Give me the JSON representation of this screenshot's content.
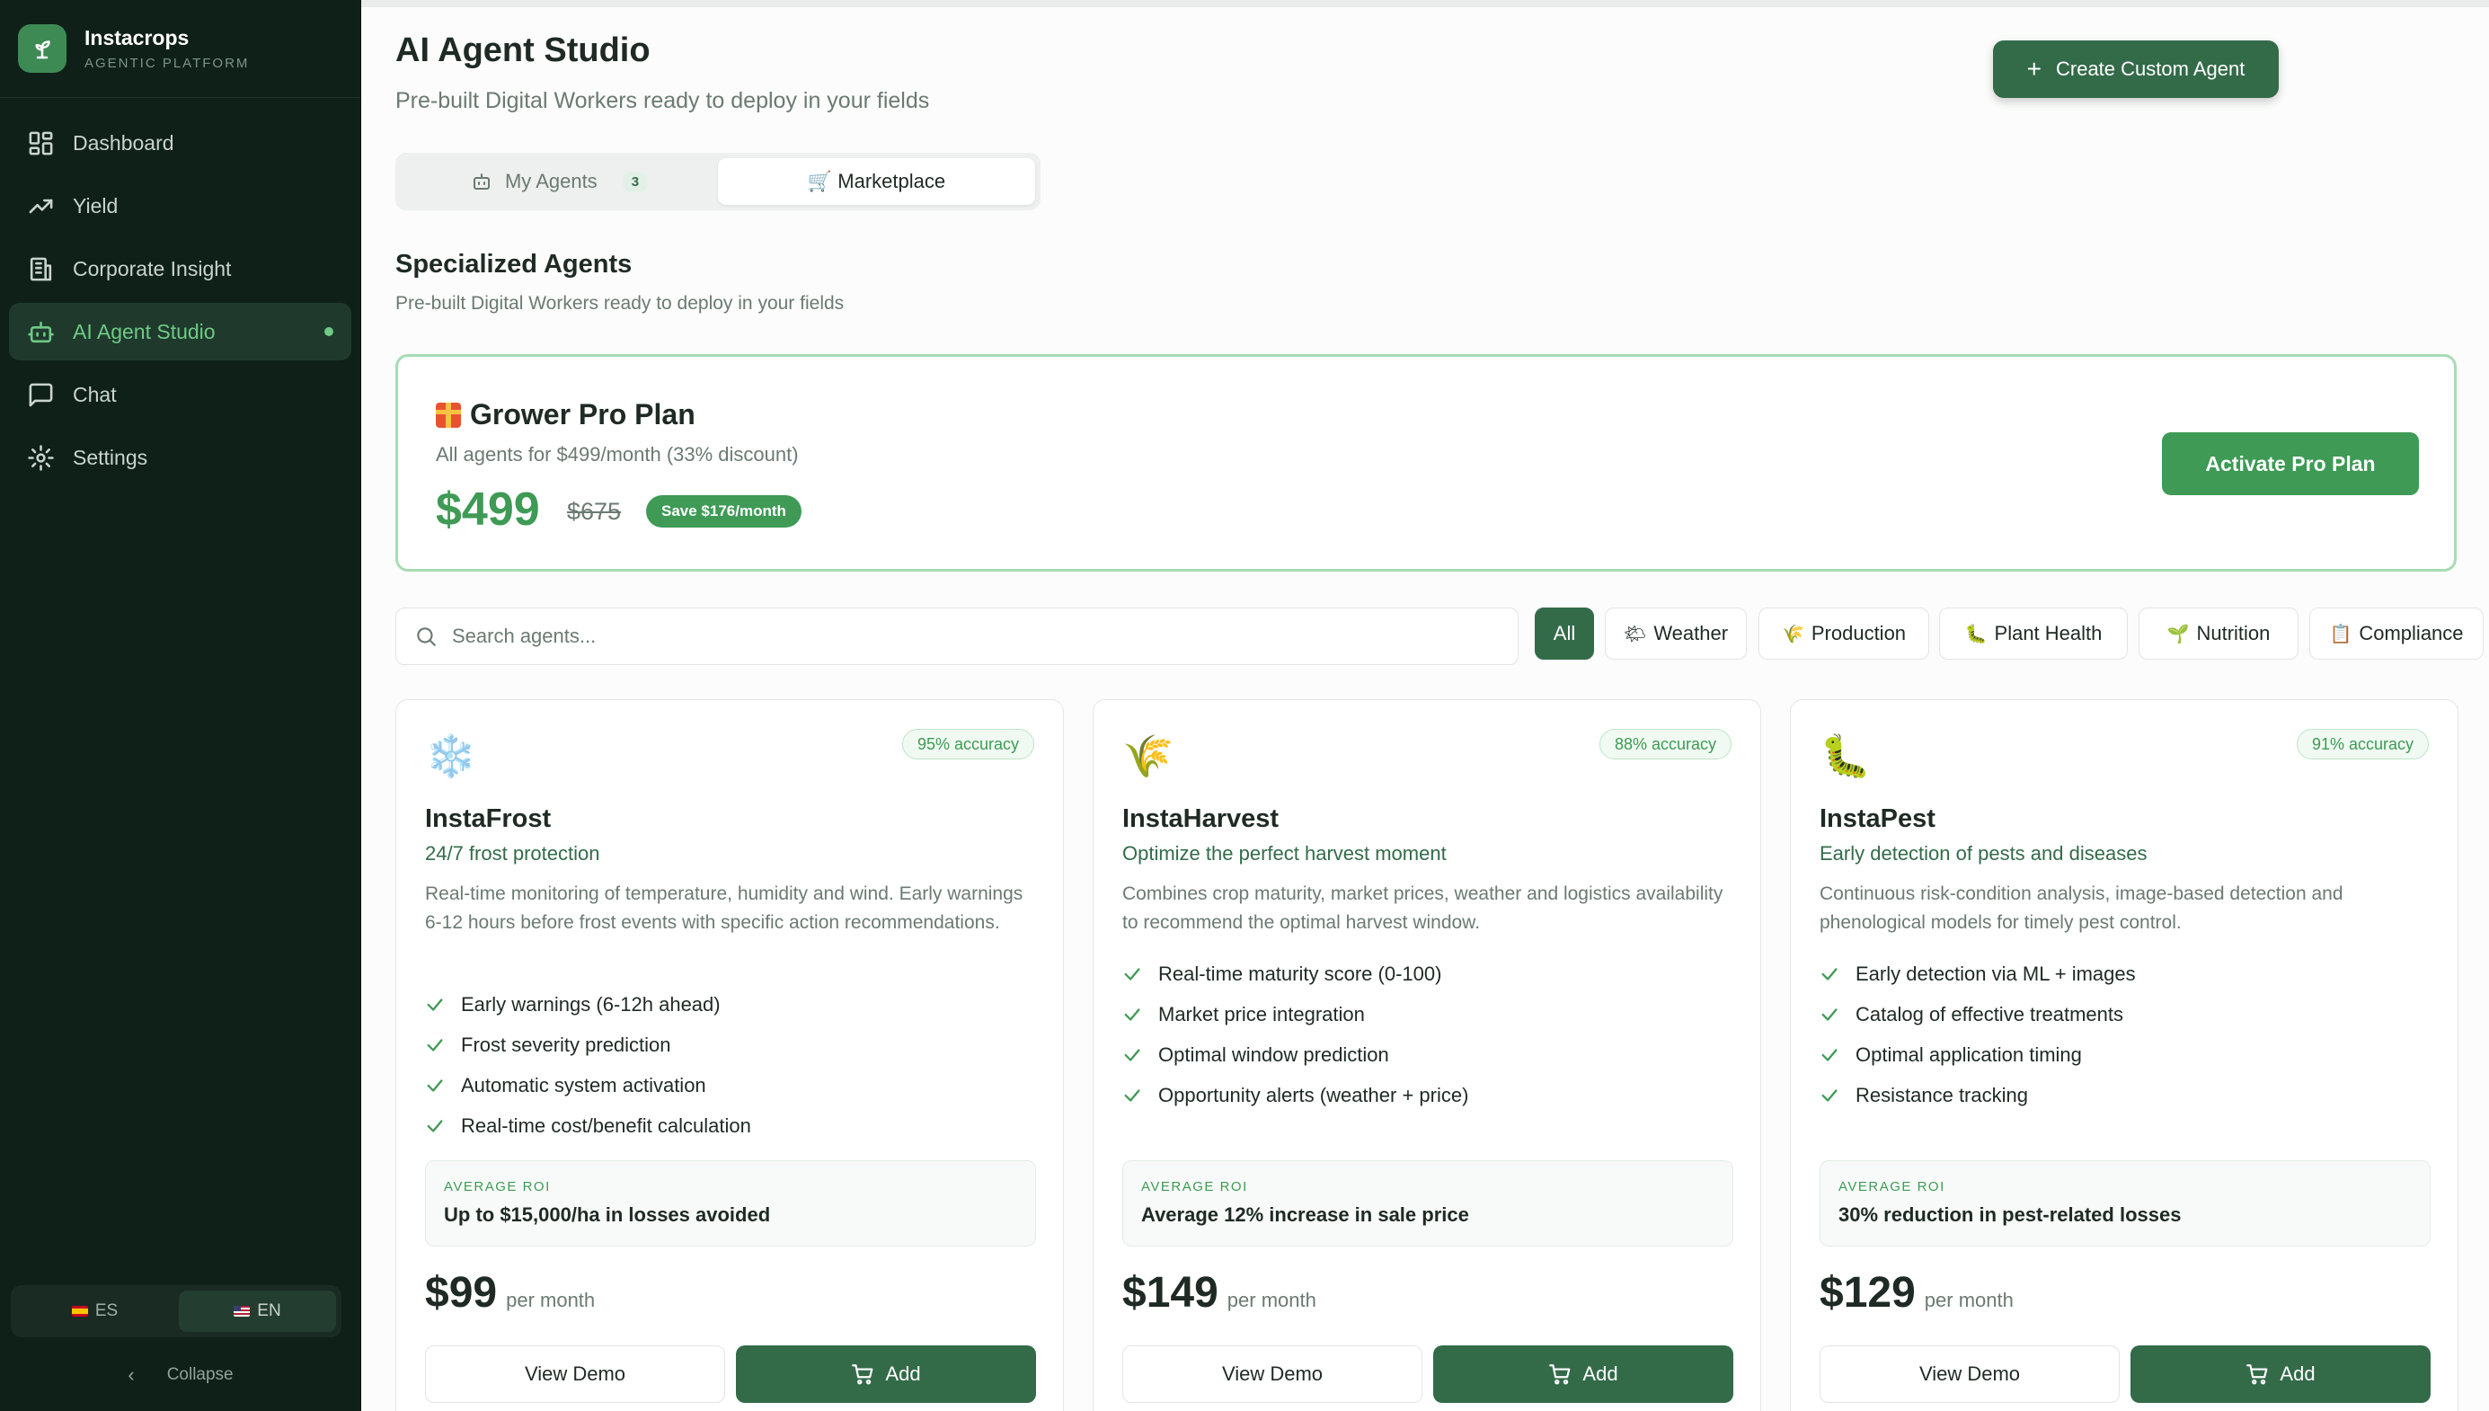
{
  "brand": {
    "name": "Instacrops",
    "subtitle": "AGENTIC PLATFORM",
    "icon": "sprout-icon"
  },
  "sidebar": {
    "items": [
      {
        "label": "Dashboard",
        "icon": "dashboard-grid-icon",
        "active": false
      },
      {
        "label": "Yield",
        "icon": "trending-up-icon",
        "active": false
      },
      {
        "label": "Corporate Insight",
        "icon": "building-icon",
        "active": false
      },
      {
        "label": "AI Agent Studio",
        "icon": "bot-icon",
        "active": true
      },
      {
        "label": "Chat",
        "icon": "chat-bubble-icon",
        "active": false
      },
      {
        "label": "Settings",
        "icon": "gear-icon",
        "active": false
      }
    ],
    "languages": [
      {
        "label": "ES",
        "flag": "es-flag-icon",
        "active": false
      },
      {
        "label": "EN",
        "flag": "us-flag-icon",
        "active": true
      }
    ],
    "collapse_label": "Collapse"
  },
  "header": {
    "title": "AI Agent Studio",
    "subtitle": "Pre-built Digital Workers ready to deploy in your fields",
    "create_button": "Create Custom Agent"
  },
  "tabs": [
    {
      "label": "My Agents",
      "count": "3",
      "active": false
    },
    {
      "label": "Marketplace",
      "active": true
    }
  ],
  "section": {
    "title": "Specialized Agents",
    "subtitle": "Pre-built Digital Workers ready to deploy in your fields"
  },
  "pro_plan": {
    "title": "Grower Pro Plan",
    "description": "All agents for $499/month (33% discount)",
    "price": "$499",
    "old_price": "$675",
    "savings": "Save $176/month",
    "button": "Activate Pro Plan"
  },
  "search": {
    "placeholder": "Search agents..."
  },
  "filters": [
    {
      "label": "All",
      "icon": "",
      "active": true
    },
    {
      "label": "Weather",
      "icon": "sun-cloud-icon",
      "active": false
    },
    {
      "label": "Production",
      "icon": "wheat-icon",
      "active": false
    },
    {
      "label": "Plant Health",
      "icon": "bug-icon",
      "active": false
    },
    {
      "label": "Nutrition",
      "icon": "seedling-icon",
      "active": false
    },
    {
      "label": "Compliance",
      "icon": "clipboard-icon",
      "active": false
    }
  ],
  "agents": [
    {
      "name": "InstaFrost",
      "icon": "snowflake-icon",
      "accuracy": "95% accuracy",
      "tagline": "24/7 frost protection",
      "description": "Real-time monitoring of temperature, humidity and wind. Early warnings 6-12 hours before frost events with specific action recommendations.",
      "features": [
        "Early warnings (6-12h ahead)",
        "Frost severity prediction",
        "Automatic system activation",
        "Real-time cost/benefit calculation"
      ],
      "roi_label": "AVERAGE ROI",
      "roi_value": "Up to $15,000/ha in losses avoided",
      "price": "$99",
      "period": "per month",
      "demo_label": "View Demo",
      "add_label": "Add"
    },
    {
      "name": "InstaHarvest",
      "icon": "wheat-icon",
      "accuracy": "88% accuracy",
      "tagline": "Optimize the perfect harvest moment",
      "description": "Combines crop maturity, market prices, weather and logistics availability to recommend the optimal harvest window.",
      "features": [
        "Real-time maturity score (0-100)",
        "Market price integration",
        "Optimal window prediction",
        "Opportunity alerts (weather + price)"
      ],
      "roi_label": "AVERAGE ROI",
      "roi_value": "Average 12% increase in sale price",
      "price": "$149",
      "period": "per month",
      "demo_label": "View Demo",
      "add_label": "Add"
    },
    {
      "name": "InstaPest",
      "icon": "bug-icon",
      "accuracy": "91% accuracy",
      "tagline": "Early detection of pests and diseases",
      "description": "Continuous risk-condition analysis, image-based detection and phenological models for timely pest control.",
      "features": [
        "Early detection via ML + images",
        "Catalog of effective treatments",
        "Optimal application timing",
        "Resistance tracking"
      ],
      "roi_label": "AVERAGE ROI",
      "roi_value": "30% reduction in pest-related losses",
      "price": "$129",
      "period": "per month",
      "demo_label": "View Demo",
      "add_label": "Add"
    }
  ],
  "colors": {
    "accent": "#3e9a55",
    "primary_dark": "#336b49",
    "sidebar_bg": "#0f2019",
    "active_nav": "#6fca86"
  }
}
